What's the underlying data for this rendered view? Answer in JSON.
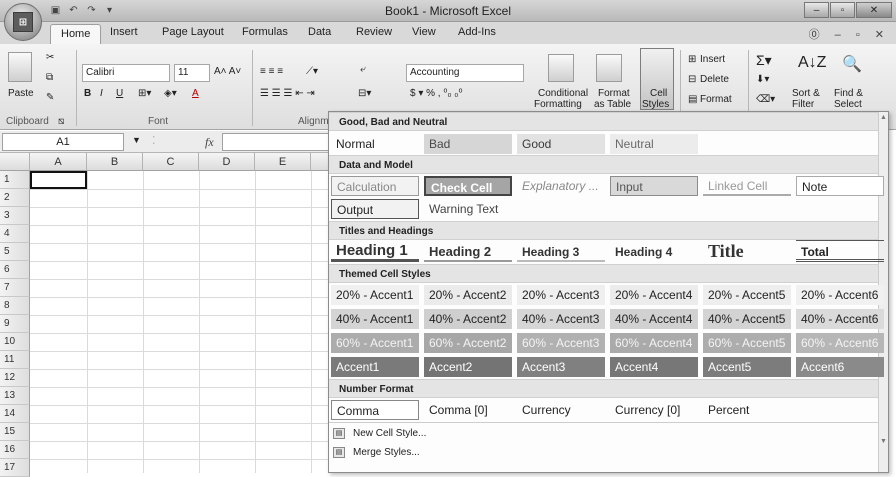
{
  "window": {
    "title": "Book1 - Microsoft Excel"
  },
  "tabs": [
    "Home",
    "Insert",
    "Page Layout",
    "Formulas",
    "Data",
    "Review",
    "View",
    "Add-Ins"
  ],
  "ribbon": {
    "clipboard": {
      "paste": "Paste",
      "label": "Clipboard"
    },
    "font": {
      "name": "Calibri",
      "size": "11",
      "label": "Font"
    },
    "alignment": {
      "label": "Alignm"
    },
    "number": {
      "format": "Accounting"
    },
    "styles": {
      "conditional": "Conditional",
      "conditional2": "Formatting",
      "format_table": "Format",
      "format_table2": "as Table",
      "cell_styles": "Cell",
      "cell_styles2": "Styles"
    },
    "cells": {
      "insert": "Insert",
      "delete": "Delete",
      "format": "Format"
    },
    "editing": {
      "sort": "Sort &",
      "sort2": "Filter",
      "find": "Find &",
      "find2": "Select"
    }
  },
  "formula_bar": {
    "name_box": "A1",
    "fx": "fx"
  },
  "sheet": {
    "columns": [
      "A",
      "B",
      "C",
      "D",
      "E"
    ],
    "rows": [
      "1",
      "2",
      "3",
      "4",
      "5",
      "6",
      "7",
      "8",
      "9",
      "10",
      "11",
      "12",
      "13",
      "14",
      "15",
      "16",
      "17"
    ]
  },
  "gallery": {
    "sections": {
      "good_bad": "Good, Bad and Neutral",
      "data_model": "Data and Model",
      "titles": "Titles and Headings",
      "themed": "Themed Cell Styles",
      "number": "Number Format"
    },
    "good_bad": [
      "Normal",
      "Bad",
      "Good",
      "Neutral"
    ],
    "data_model_row1": [
      "Calculation",
      "Check Cell",
      "Explanatory ...",
      "Input",
      "Linked Cell",
      "Note"
    ],
    "data_model_row2": [
      "Output",
      "Warning Text"
    ],
    "titles": [
      "Heading 1",
      "Heading 2",
      "Heading 3",
      "Heading 4",
      "Title",
      "Total"
    ],
    "accent20": [
      "20% - Accent1",
      "20% - Accent2",
      "20% - Accent3",
      "20% - Accent4",
      "20% - Accent5",
      "20% - Accent6"
    ],
    "accent40": [
      "40% - Accent1",
      "40% - Accent2",
      "40% - Accent3",
      "40% - Accent4",
      "40% - Accent5",
      "40% - Accent6"
    ],
    "accent60": [
      "60% - Accent1",
      "60% - Accent2",
      "60% - Accent3",
      "60% - Accent4",
      "60% - Accent5",
      "60% - Accent6"
    ],
    "accent": [
      "Accent1",
      "Accent2",
      "Accent3",
      "Accent4",
      "Accent5",
      "Accent6"
    ],
    "number_format": [
      "Comma",
      "Comma [0]",
      "Currency",
      "Currency [0]",
      "Percent"
    ],
    "menu": {
      "new_style": "New Cell Style...",
      "merge": "Merge Styles..."
    }
  }
}
